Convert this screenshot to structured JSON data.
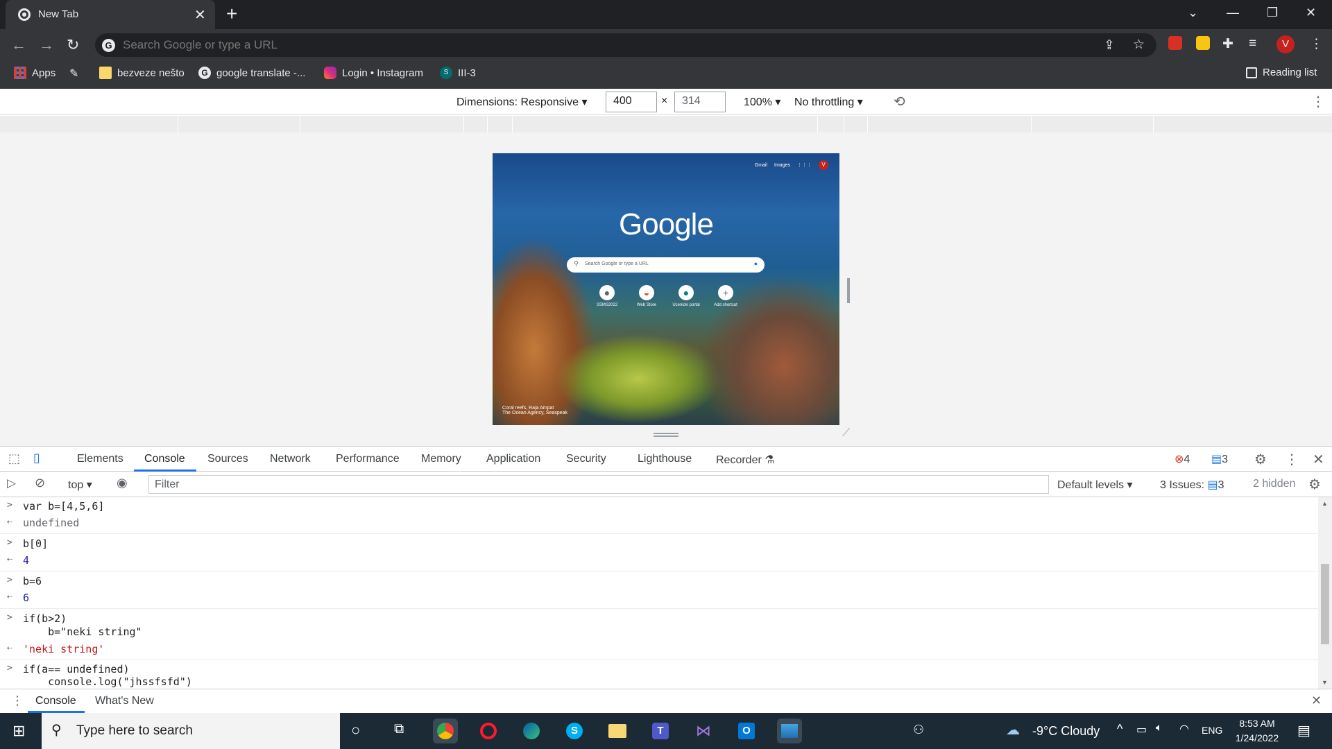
{
  "browser": {
    "tab_title": "New Tab",
    "close_tab": "✕",
    "new_tab": "+",
    "omnibox_placeholder": "Search Google or type a URL",
    "profile_initial": "V"
  },
  "bookmarks": {
    "apps": "Apps",
    "items": [
      "bezveze nešto",
      "google translate -...",
      "Login • Instagram",
      "III-3"
    ],
    "reading_list": "Reading list"
  },
  "device_toolbar": {
    "dimensions_label": "Dimensions: Responsive",
    "width": "400",
    "times": "×",
    "height": "314",
    "zoom": "100%",
    "throttling": "No throttling"
  },
  "viewport": {
    "links": [
      "Gmail",
      "Images"
    ],
    "avatar": "V",
    "logo": "Google",
    "search_placeholder": "Search Google or type a URL",
    "shortcuts": [
      "SSMS2022",
      "Web Store",
      "Ucenicki portal",
      "Add shortcut"
    ],
    "credit_line1": "Coral reefs, Raja Ampat",
    "credit_line2": "The Ocean Agency, Seaspeak"
  },
  "devtools": {
    "tabs": [
      "Elements",
      "Console",
      "Sources",
      "Network",
      "Performance",
      "Memory",
      "Application",
      "Security",
      "Lighthouse",
      "Recorder"
    ],
    "errors_count": "4",
    "messages_count": "3",
    "context": "top",
    "filter_placeholder": "Filter",
    "levels": "Default levels",
    "issues_label": "3 Issues:",
    "issues_count": "3",
    "hidden": "2 hidden"
  },
  "console": {
    "lines": [
      {
        "kind": "input",
        "text": "var b=[4,5,6]"
      },
      {
        "kind": "output",
        "text": "undefined"
      },
      {
        "kind": "input",
        "text": "b[0]"
      },
      {
        "kind": "output",
        "text": "4"
      },
      {
        "kind": "input",
        "text": "b=6"
      },
      {
        "kind": "output",
        "text": "6"
      },
      {
        "kind": "input",
        "text": "if(b>2)"
      },
      {
        "kind": "input-cont",
        "text": "    b=\"neki string\""
      },
      {
        "kind": "output",
        "text": "'neki string'"
      },
      {
        "kind": "input",
        "text": "if(a== undefined)"
      },
      {
        "kind": "input-cont",
        "text": "    console.log(\"jhssfsfd\")"
      }
    ]
  },
  "drawer": {
    "tabs": [
      "Console",
      "What's New"
    ]
  },
  "taskbar": {
    "search_placeholder": "Type here to search",
    "weather": "-9°C  Cloudy",
    "language": "ENG",
    "time": "8:53 AM",
    "date": "1/24/2022"
  },
  "colors": {
    "accent": "#1a73e8",
    "error": "#d93025",
    "string": "#c41a16",
    "number": "#1a1aa6"
  }
}
